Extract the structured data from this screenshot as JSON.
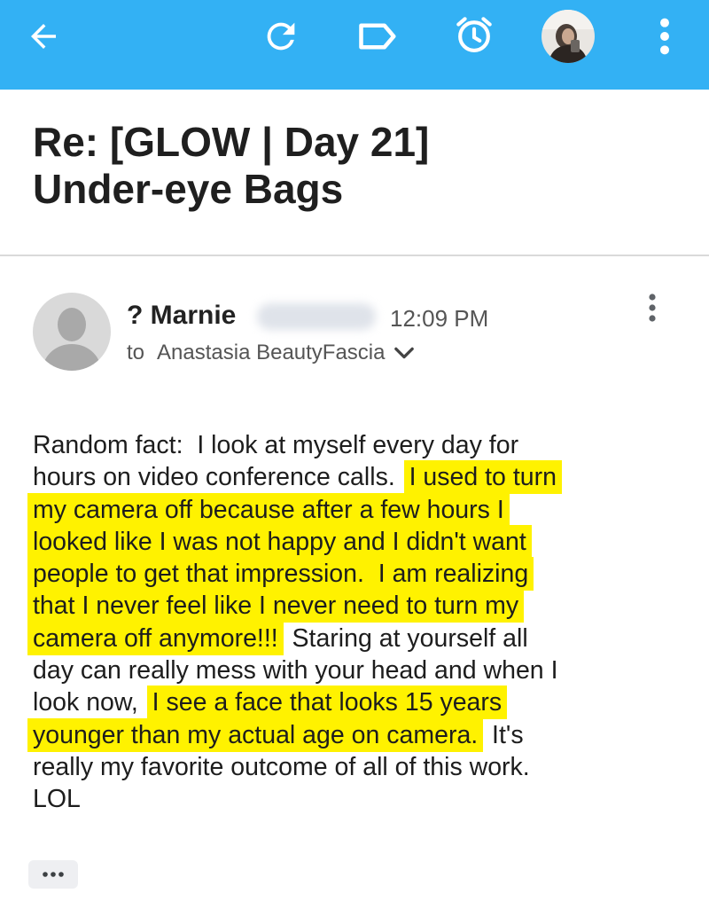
{
  "theme": {
    "appbar_color": "#33b1f4",
    "highlight_color": "#fff200",
    "divider_color": "#dadada",
    "icon_color": "#ffffff",
    "button_bg": "#eeeff2",
    "avatar_bg": "#d9d9d9",
    "avatar_fg": "#a9a9a9"
  },
  "toolbar": {
    "icons": [
      "back-arrow-icon",
      "refresh-icon",
      "label-icon",
      "alarm-clock-icon",
      "account-avatar",
      "more-vert-icon"
    ]
  },
  "email": {
    "subject_line1": "Re: [GLOW | Day 21]",
    "subject_line2": "Under-eye Bags",
    "sender_name": "? Marnie",
    "time": "12:09 PM",
    "to_label": "to",
    "recipient": "Anastasia BeautyFascia",
    "body_lines": [
      [
        {
          "t": "Random fact:  I look at myself every day for",
          "h": false
        }
      ],
      [
        {
          "t": "hours on video conference calls.  ",
          "h": false
        },
        {
          "t": "I used to turn",
          "h": true
        }
      ],
      [
        {
          "t": "my camera off because after a few hours I",
          "h": true
        }
      ],
      [
        {
          "t": "looked like I was not happy and I didn't want",
          "h": true
        }
      ],
      [
        {
          "t": "people to get that impression.  I am realizing",
          "h": true
        }
      ],
      [
        {
          "t": "that I never feel like I never need to turn my",
          "h": true
        }
      ],
      [
        {
          "t": "camera off anymore!!!",
          "h": true
        },
        {
          "t": "  Staring at yourself all",
          "h": false
        }
      ],
      [
        {
          "t": "day can really mess with your head and when I",
          "h": false
        }
      ],
      [
        {
          "t": "look now,  ",
          "h": false
        },
        {
          "t": "I see a face that looks 15 years",
          "h": true
        }
      ],
      [
        {
          "t": "younger than my actual age on camera.",
          "h": true
        },
        {
          "t": "  It's",
          "h": false
        }
      ],
      [
        {
          "t": "really my favorite outcome of all of this work.",
          "h": false
        }
      ],
      [
        {
          "t": "LOL",
          "h": false
        }
      ]
    ]
  }
}
